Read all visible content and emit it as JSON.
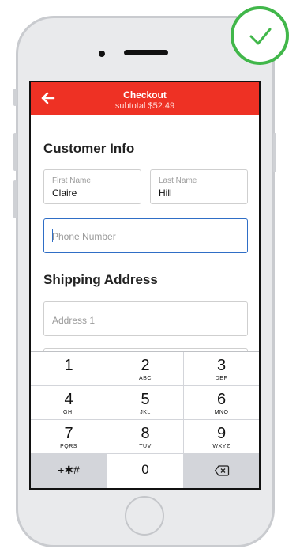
{
  "app": {
    "header": {
      "title": "Checkout",
      "subtitle": "subtotal $52.49"
    },
    "customer_info": {
      "title": "Customer Info",
      "first_name": {
        "label": "First Name",
        "value": "Claire"
      },
      "last_name": {
        "label": "Last Name",
        "value": "Hill"
      },
      "phone": {
        "placeholder": "Phone Number"
      }
    },
    "shipping": {
      "title": "Shipping Address",
      "address1": {
        "placeholder": "Address 1"
      }
    }
  },
  "keypad": {
    "keys": [
      {
        "num": "1",
        "letters": ""
      },
      {
        "num": "2",
        "letters": "ABC"
      },
      {
        "num": "3",
        "letters": "DEF"
      },
      {
        "num": "4",
        "letters": "GHI"
      },
      {
        "num": "5",
        "letters": "JKL"
      },
      {
        "num": "6",
        "letters": "MNO"
      },
      {
        "num": "7",
        "letters": "PQRS"
      },
      {
        "num": "8",
        "letters": "TUV"
      },
      {
        "num": "9",
        "letters": "WXYZ"
      }
    ],
    "symbols": "+✱#",
    "zero": "0"
  },
  "colors": {
    "header_bg": "#ee3124",
    "active_border": "#2f6ec6",
    "badge_green": "#41b74a"
  }
}
